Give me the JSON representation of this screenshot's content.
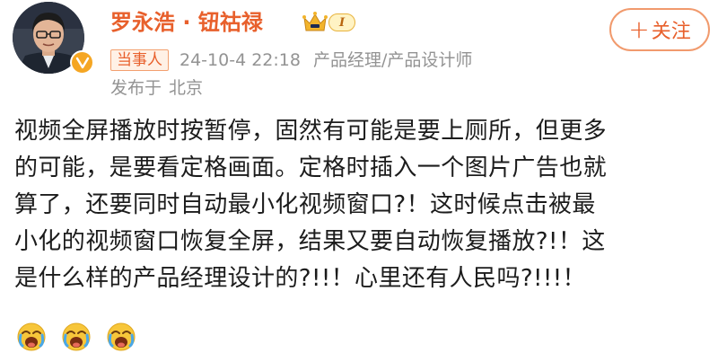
{
  "user": {
    "name": "罗永浩 · 钮祜禄",
    "level": "I",
    "avatar_icon": "person-avatar",
    "verified_icon": "verified-v-icon"
  },
  "follow": {
    "label": "关注",
    "plus": "+"
  },
  "meta": {
    "tag": "当事人",
    "time": "24-10-4 22:18",
    "source": "产品经理/产品设计师",
    "location_prefix": "发布于",
    "location": "北京"
  },
  "post": {
    "lines": [
      "视频全屏播放时按暂停，固然有可能是要上厕所，但更多",
      "的可能，是要看定格画面。定格时插入一个图片广告也就",
      "算了，还要同时自动最小化视频窗口?！这时候点击被最",
      "小化的视频窗口恢复全屏，结果又要自动恢复播放?!！这",
      "是什么样的产品经理设计的?!!！心里还有人民吗?!!!！"
    ],
    "emojis": [
      "crying-face-emoji",
      "crying-face-emoji",
      "crying-face-emoji"
    ]
  },
  "colors": {
    "accent": "#e8602c",
    "meta_gray": "#939393",
    "badge_gold": "#f5a623"
  }
}
